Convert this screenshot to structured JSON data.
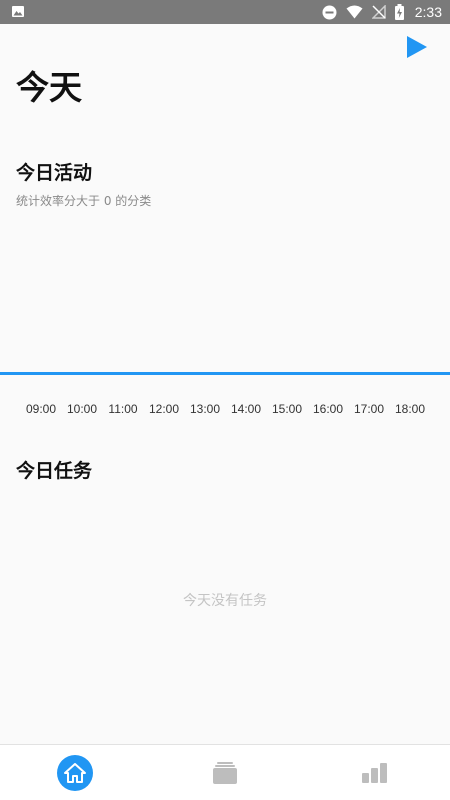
{
  "status_bar": {
    "time": "2:33",
    "icons": [
      "gallery-icon",
      "do-not-disturb-icon",
      "wifi-icon",
      "no-signal-icon",
      "battery-charging-icon"
    ]
  },
  "header": {
    "title": "今天",
    "play_icon": "play-icon"
  },
  "activity": {
    "title": "今日活动",
    "subtitle": "统计效率分大于 0 的分类",
    "timeline_color": "#2196f3",
    "hours": [
      "09:00",
      "10:00",
      "11:00",
      "12:00",
      "13:00",
      "14:00",
      "15:00",
      "16:00",
      "17:00",
      "18:00"
    ]
  },
  "tasks": {
    "title": "今日任务",
    "empty_text": "今天没有任务"
  },
  "bottom_nav": {
    "items": [
      {
        "icon": "home-icon",
        "active": true
      },
      {
        "icon": "task-stack-icon",
        "active": false
      },
      {
        "icon": "stats-bars-icon",
        "active": false
      }
    ],
    "accent": "#2196f3",
    "inactive_color": "#bdbdbd"
  }
}
